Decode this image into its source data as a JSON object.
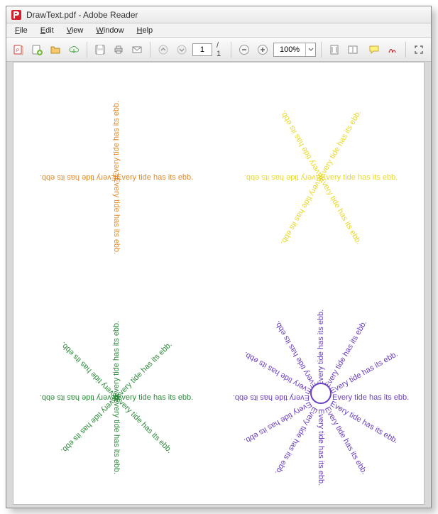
{
  "window": {
    "title": "DrawText.pdf - Adobe Reader"
  },
  "menu": {
    "items": [
      "File",
      "Edit",
      "View",
      "Window",
      "Help"
    ]
  },
  "toolbar": {
    "page_current": "1",
    "page_total": "/ 1",
    "zoom": "100%"
  },
  "document": {
    "phrase": "Every tide has its ebb.",
    "patterns": [
      {
        "quadrant": "tl",
        "color": "#e08a2a",
        "rays": 4,
        "offset": 0,
        "ring": false
      },
      {
        "quadrant": "tr",
        "color": "#e8d82a",
        "rays": 6,
        "offset": 0,
        "ring": false
      },
      {
        "quadrant": "bl",
        "color": "#2d8a3a",
        "rays": 8,
        "offset": 0,
        "ring": false
      },
      {
        "quadrant": "br",
        "color": "#6a3fc0",
        "rays": 12,
        "offset": 16,
        "ring": true
      }
    ]
  }
}
